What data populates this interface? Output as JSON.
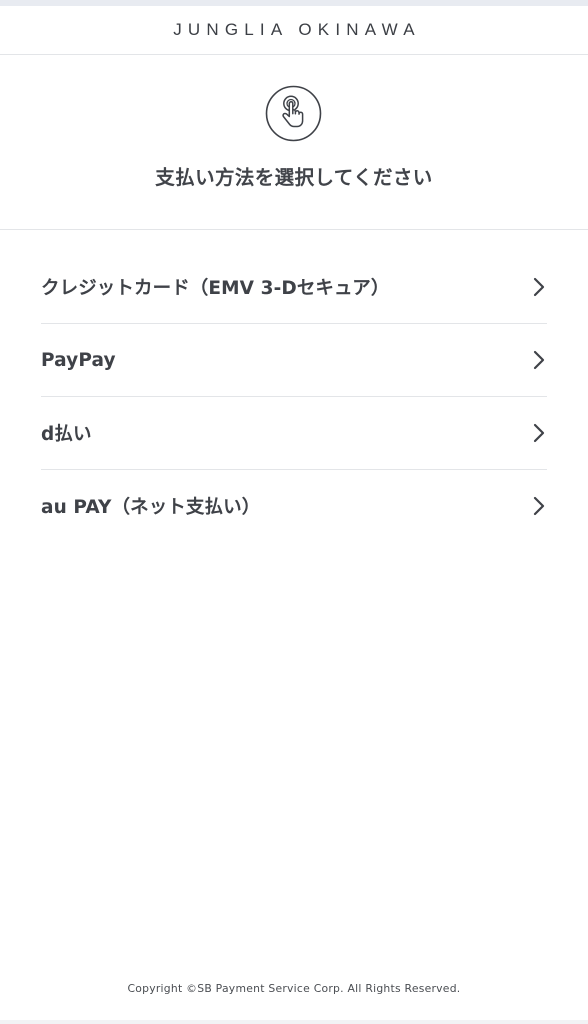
{
  "header": {
    "brand": "JUNGLIA OKINAWA"
  },
  "prompt": {
    "icon": "tap-finger-icon",
    "title": "支払い方法を選択してください"
  },
  "payment_methods": [
    {
      "label": "クレジットカード（EMV 3-Dセキュア）",
      "icon": "chevron-right-icon"
    },
    {
      "label": "PayPay",
      "icon": "chevron-right-icon"
    },
    {
      "label": "d払い",
      "icon": "chevron-right-icon"
    },
    {
      "label": "au PAY（ネット支払い）",
      "icon": "chevron-right-icon"
    }
  ],
  "footer": {
    "copyright": "Copyright ©SB Payment Service Corp. All Rights Reserved."
  },
  "colors": {
    "text": "#3f4248",
    "divider": "#e3e5e8",
    "top_strip": "#e8ebf1",
    "background": "#ffffff"
  }
}
